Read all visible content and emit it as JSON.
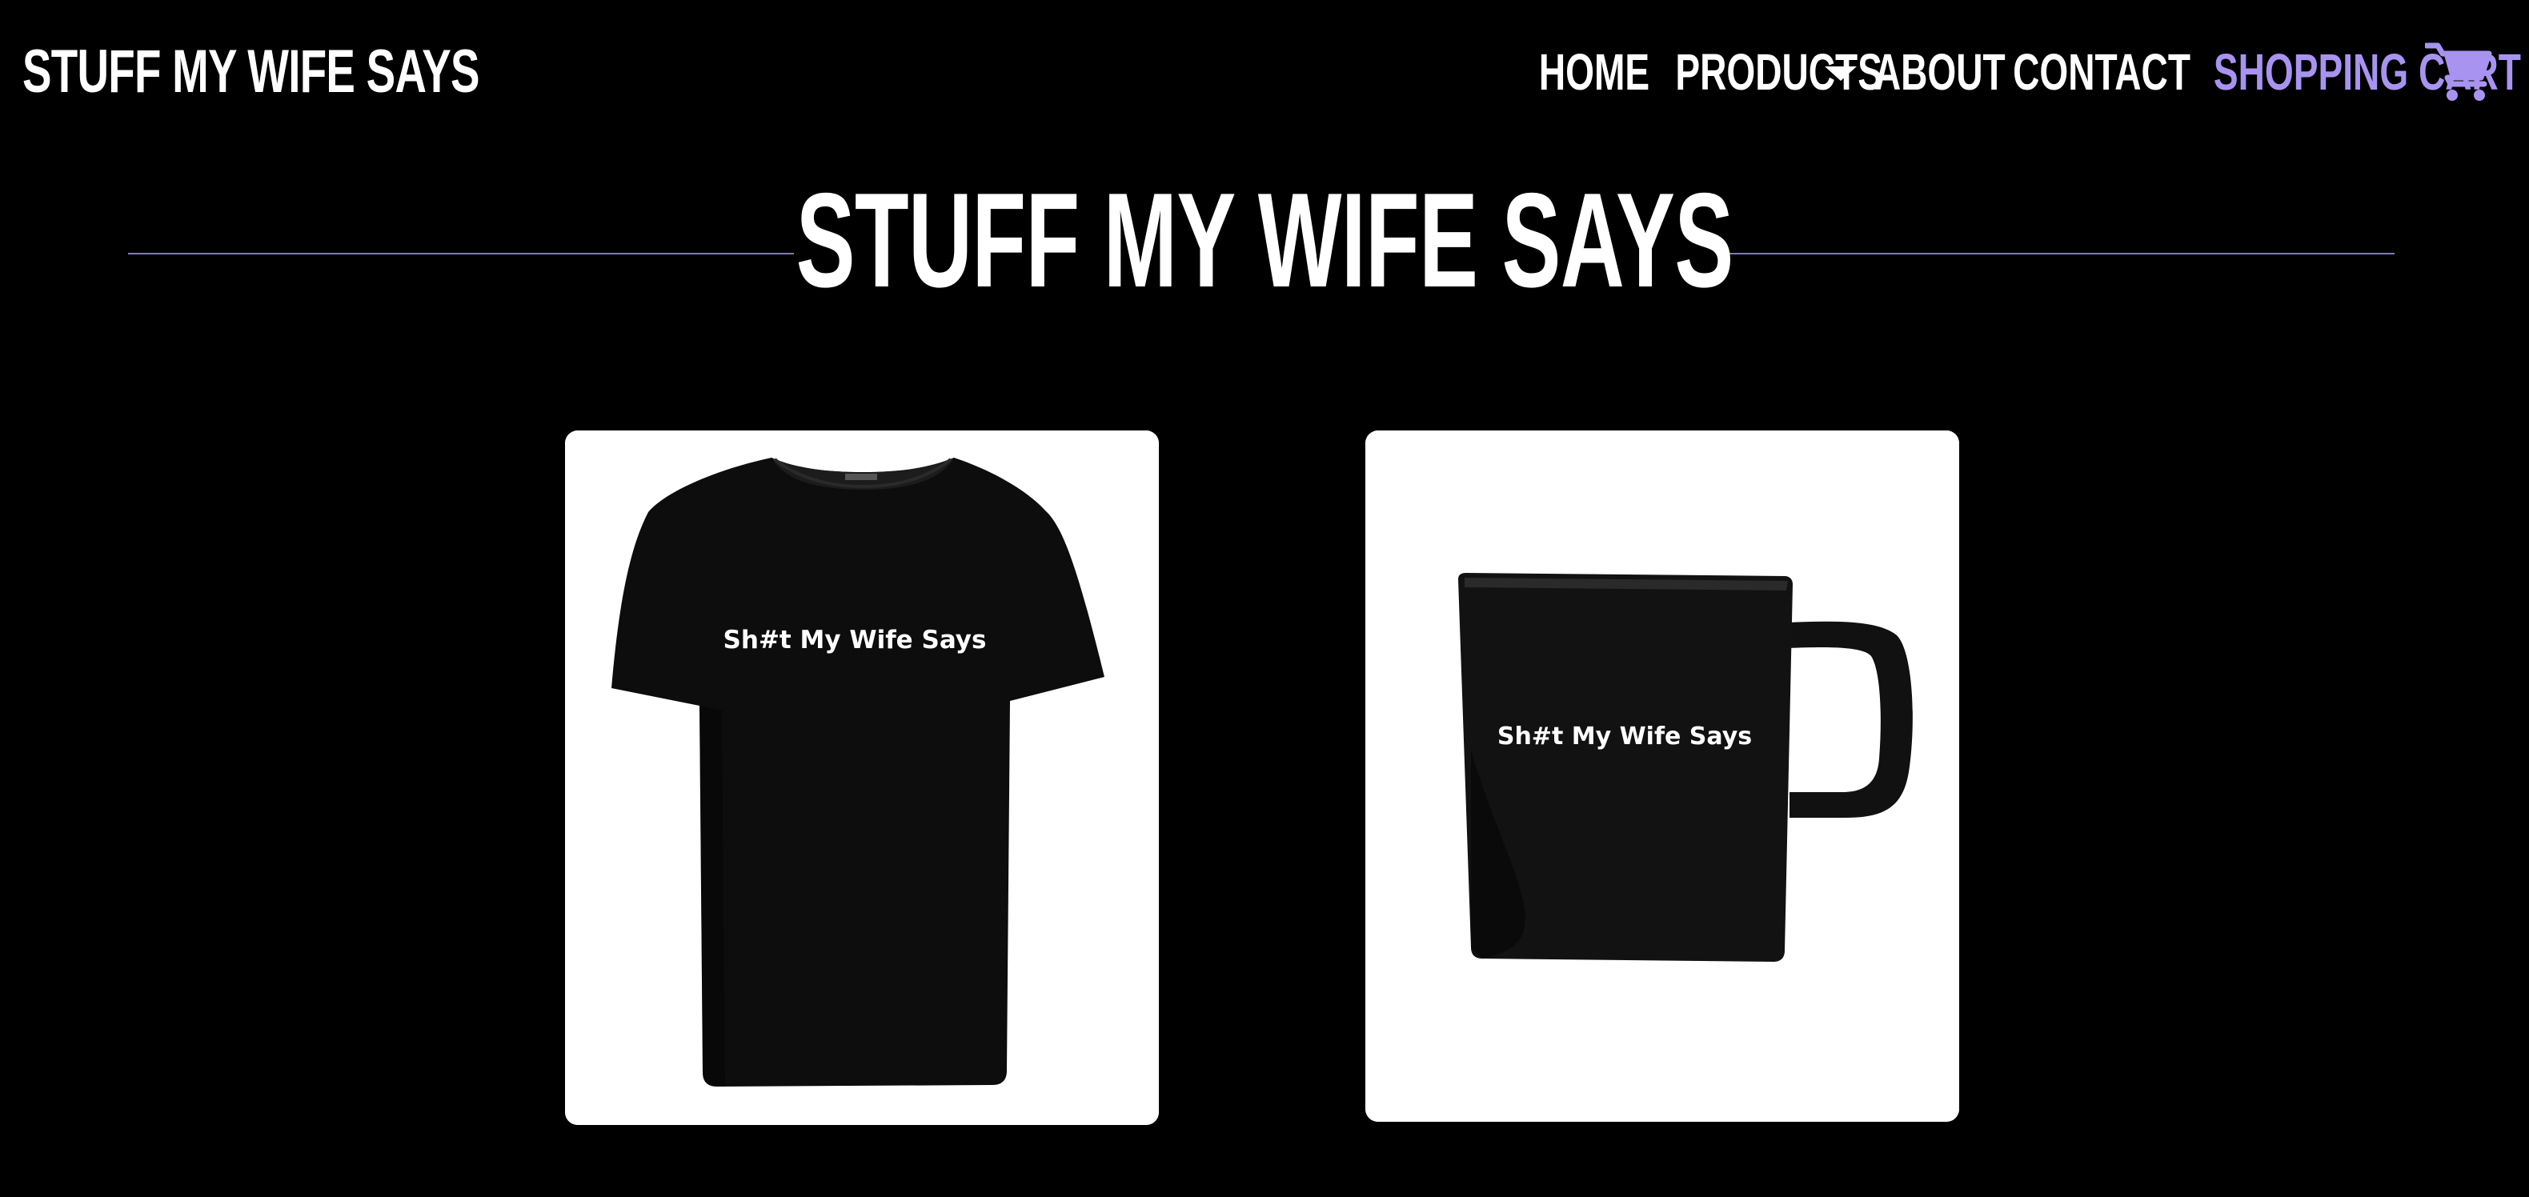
{
  "header": {
    "brand": "STUFF MY WIFE SAYS",
    "nav": {
      "home": "HOME",
      "products": "PRODUCTS",
      "about": "ABOUT",
      "contact": "CONTACT",
      "cart": "SHOPPING CART"
    },
    "icons": {
      "products_dropdown": "caret-down-icon",
      "cart": "shopping-cart-icon"
    }
  },
  "hero": {
    "title": "STUFF MY WIFE SAYS"
  },
  "products": [
    {
      "type": "t-shirt",
      "print_text": "Sh#t My Wife Says"
    },
    {
      "type": "mug",
      "print_text": "Sh#t My Wife Says"
    }
  ],
  "colors": {
    "background": "#000000",
    "accent": "#a993f0",
    "divider": "#7f76d8",
    "card": "#ffffff"
  }
}
